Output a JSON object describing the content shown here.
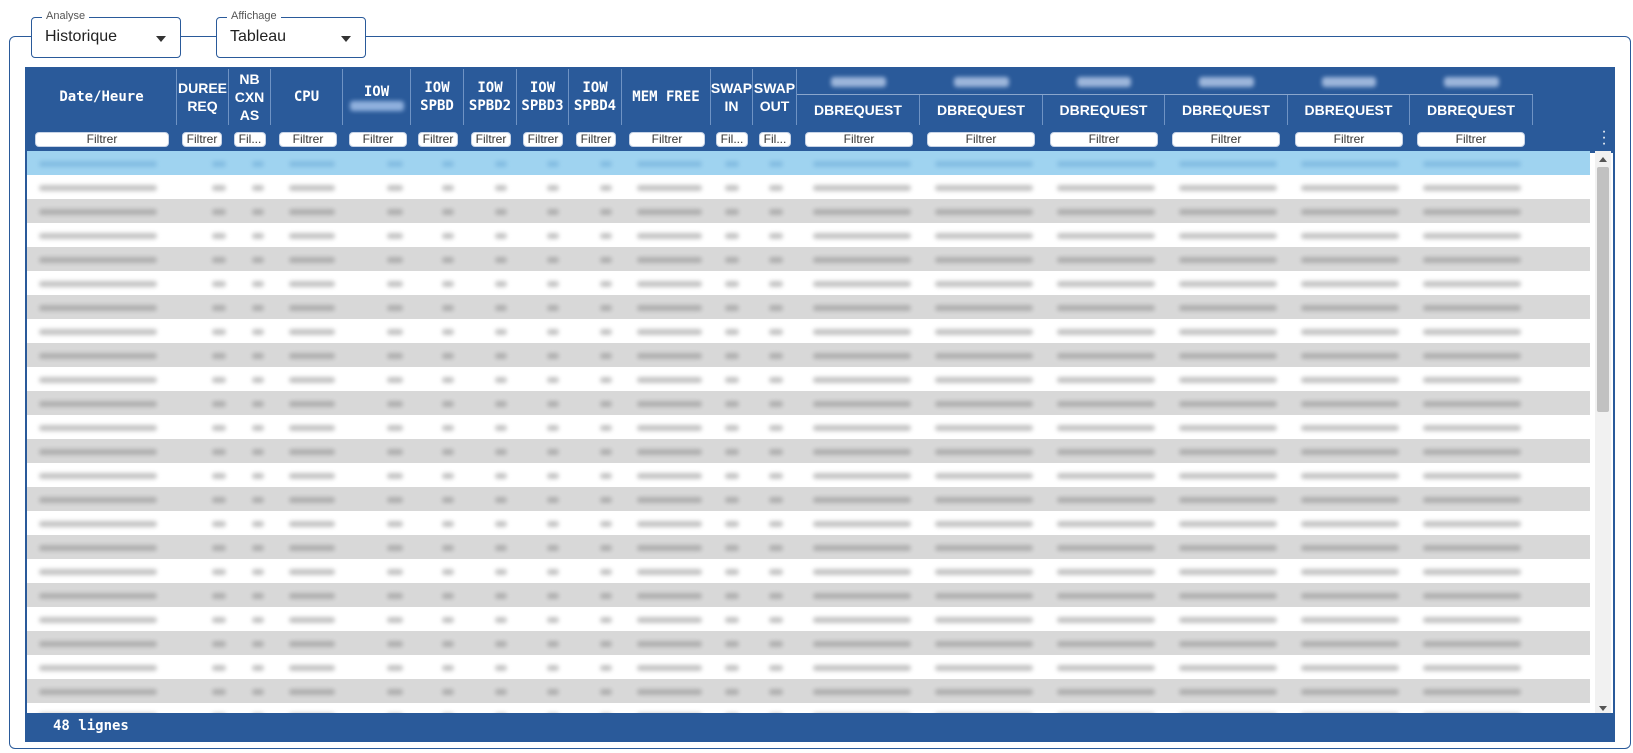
{
  "selectors": {
    "analyse": {
      "legend": "Analyse",
      "value": "Historique"
    },
    "affichage": {
      "legend": "Affichage",
      "value": "Tableau"
    }
  },
  "table": {
    "columns": [
      {
        "label": "Date/Heure"
      },
      {
        "label": "DUREE\nREQ"
      },
      {
        "label": "NB\nCXN\nAS"
      },
      {
        "label": "CPU"
      },
      {
        "label": "IOW"
      },
      {
        "label": "IOW\nSPBD"
      },
      {
        "label": "IOW\nSPBD2"
      },
      {
        "label": "IOW\nSPBD3"
      },
      {
        "label": "IOW\nSPBD4"
      },
      {
        "label": "MEM FREE"
      },
      {
        "label": "SWAP\nIN"
      },
      {
        "label": "SWAP\nOUT"
      },
      {
        "label": "DBREQUEST"
      },
      {
        "label": "DBREQUEST"
      },
      {
        "label": "DBREQUEST"
      },
      {
        "label": "DBREQUEST"
      },
      {
        "label": "DBREQUEST"
      },
      {
        "label": "DBREQUEST"
      }
    ],
    "filter_placeholder": "Filtrer",
    "filter_placeholder_short": "Fil...",
    "footer": "48 lignes"
  },
  "colors": {
    "header": "#2a5a9a",
    "selected_row": "#9fd3f0",
    "alt_row": "#d8d8d8"
  }
}
